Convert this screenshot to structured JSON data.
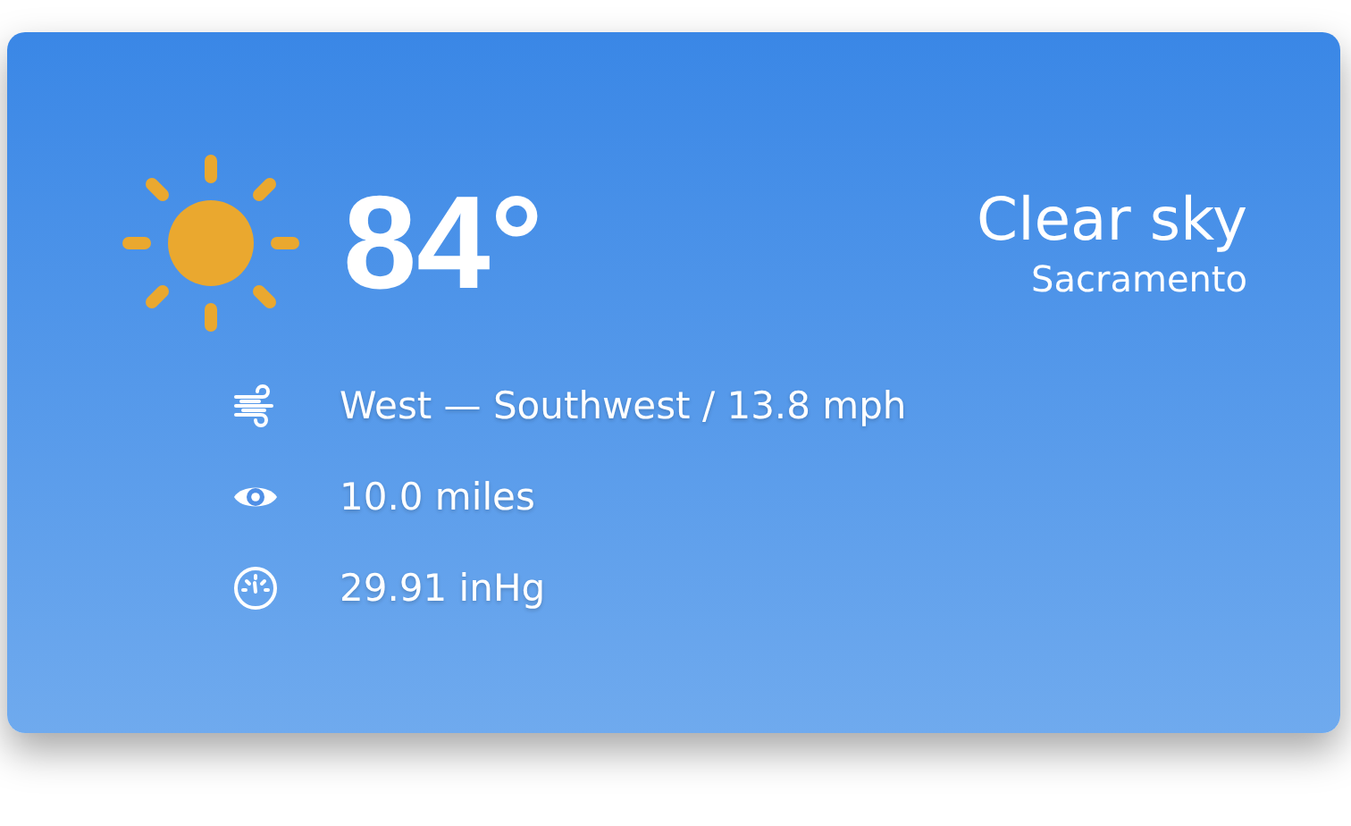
{
  "current": {
    "temperature": "84°",
    "condition": "Clear sky",
    "location": "Sacramento"
  },
  "details": [
    {
      "kind": "wind",
      "text": "West — Southwest / 13.8 mph"
    },
    {
      "kind": "visibility",
      "text": "10.0 miles"
    },
    {
      "kind": "pressure",
      "text": "29.91 inHg"
    }
  ]
}
